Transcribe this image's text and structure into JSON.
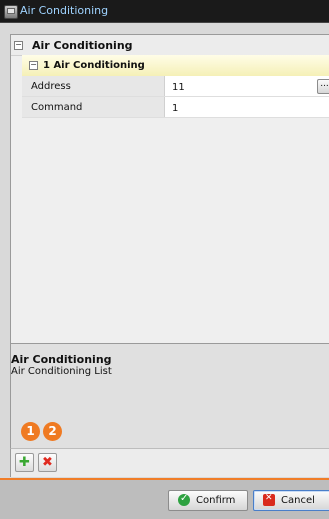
{
  "window": {
    "title": "Air Conditioning",
    "icon": "app-window-icon"
  },
  "tree": {
    "group_label": "Air Conditioning",
    "item_label": "1 Air Conditioning",
    "properties": [
      {
        "name": "Address",
        "value": "11",
        "has_browse": true,
        "browse_label": "..."
      },
      {
        "name": "Command",
        "value": "1",
        "has_browse": false
      }
    ]
  },
  "description": {
    "title": "Air Conditioning",
    "text": "Air Conditioning List"
  },
  "toolbar": {
    "add_icon": "add-plus-icon",
    "delete_icon": "delete-x-icon"
  },
  "markers": [
    "1",
    "2"
  ],
  "footer": {
    "confirm_label": "Confirm",
    "cancel_label": "Cancel"
  },
  "colors": {
    "accent": "#f07d28",
    "title_text": "#9fd3ff",
    "add": "#3aa832",
    "delete": "#e02a1f"
  }
}
